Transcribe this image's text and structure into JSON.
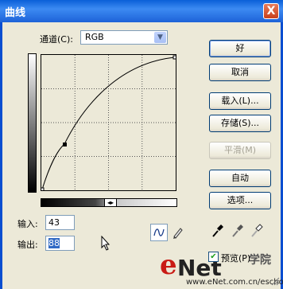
{
  "window": {
    "title": "曲线",
    "close_label": "X"
  },
  "channel": {
    "label": "通道(C):",
    "value": "RGB"
  },
  "buttons": {
    "ok": "好",
    "cancel": "取消",
    "load": "载入(L)...",
    "save": "存储(S)...",
    "smooth": "平滑(M)",
    "auto": "自动",
    "options": "选项..."
  },
  "input": {
    "label": "输入:",
    "value": "43"
  },
  "output": {
    "label": "输出:",
    "value": "88"
  },
  "preview": {
    "label": "预览(P)",
    "checked": true
  },
  "watermark": {
    "brand_e": "e",
    "brand_rest": "Net",
    "url": "www.eNet.com.cn/eschool",
    "cn_text": "学院"
  },
  "colors": {
    "accent": "#316ac5",
    "titlebar": "#1d62d8"
  }
}
